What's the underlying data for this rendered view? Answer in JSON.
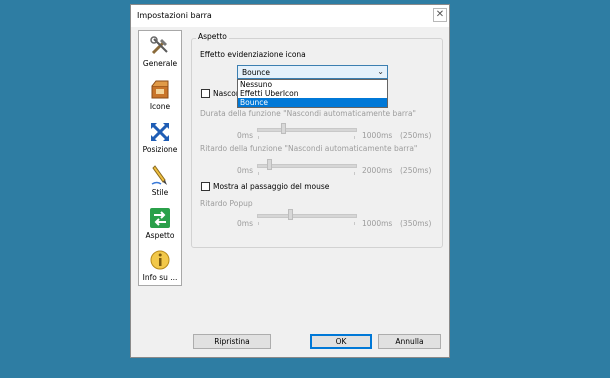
{
  "window": {
    "title": "Impostazioni barra",
    "close_glyph": "✕"
  },
  "sidebar": {
    "items": [
      {
        "label": "Generale",
        "icon": "tools-icon"
      },
      {
        "label": "Icone",
        "icon": "box-icon"
      },
      {
        "label": "Posizione",
        "icon": "move-arrows-icon"
      },
      {
        "label": "Stile",
        "icon": "pencil-icon"
      },
      {
        "label": "Aspetto",
        "icon": "swap-arrows-icon"
      },
      {
        "label": "Info su ...",
        "icon": "info-icon"
      }
    ]
  },
  "aspect": {
    "group_title": "Aspetto",
    "effect_label": "Effetto evidenziazione icona",
    "effect_selected": "Bounce",
    "effect_options": [
      "Nessuno",
      "Effetti UberIcon",
      "Bounce"
    ],
    "autohide_checkbox_label": "Nascondi",
    "duration_label": "Durata della funzione \"Nascondi automaticamente barra\"",
    "duration_min": "0ms",
    "duration_max": "1000ms",
    "duration_value": "(250ms)",
    "delay_label": "Ritardo della funzione \"Nascondi automaticamente barra\"",
    "delay_min": "0ms",
    "delay_max": "2000ms",
    "delay_value": "(250ms)",
    "hover_checkbox_label": "Mostra al passaggio del mouse",
    "popup_label": "Ritardo Popup",
    "popup_min": "0ms",
    "popup_max": "1000ms",
    "popup_value": "(350ms)"
  },
  "buttons": {
    "reset": "Ripristina",
    "ok": "OK",
    "cancel": "Annulla"
  },
  "colors": {
    "desktop": "#2e7da3",
    "selection": "#0078d7",
    "accent": "#3c7fb1"
  }
}
